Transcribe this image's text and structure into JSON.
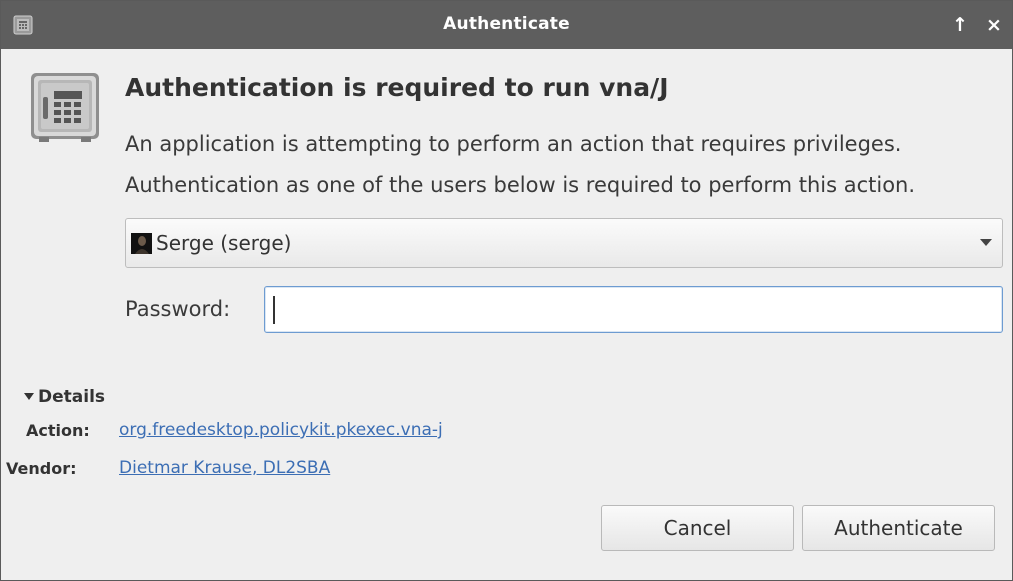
{
  "window": {
    "title": "Authenticate",
    "app_icon": "keyring-safe-icon",
    "controls": {
      "keep_above": "↑",
      "close": "×"
    }
  },
  "dialog": {
    "icon": "safe-lock-icon",
    "heading": "Authentication is required to run vna/J",
    "description_line1": "An application is attempting to perform an action that requires privileges.",
    "description_line2": "Authentication as one of the users below is required to perform this action."
  },
  "user_select": {
    "selected": "Serge (serge)",
    "avatar_icon": "user-avatar-icon"
  },
  "password": {
    "label": "Password:",
    "value": "",
    "placeholder": ""
  },
  "details": {
    "toggle_label": "Details",
    "expanded": true,
    "action_label": "Action:",
    "action_value": "org.freedesktop.policykit.pkexec.vna-j",
    "vendor_label": "Vendor:",
    "vendor_value": "Dietmar Krause, DL2SBA"
  },
  "buttons": {
    "cancel": "Cancel",
    "authenticate": "Authenticate"
  },
  "colors": {
    "titlebar": "#5e5e5e",
    "window_bg": "#efefef",
    "link": "#3c6eb4",
    "focus_border": "#6d9bd1"
  }
}
